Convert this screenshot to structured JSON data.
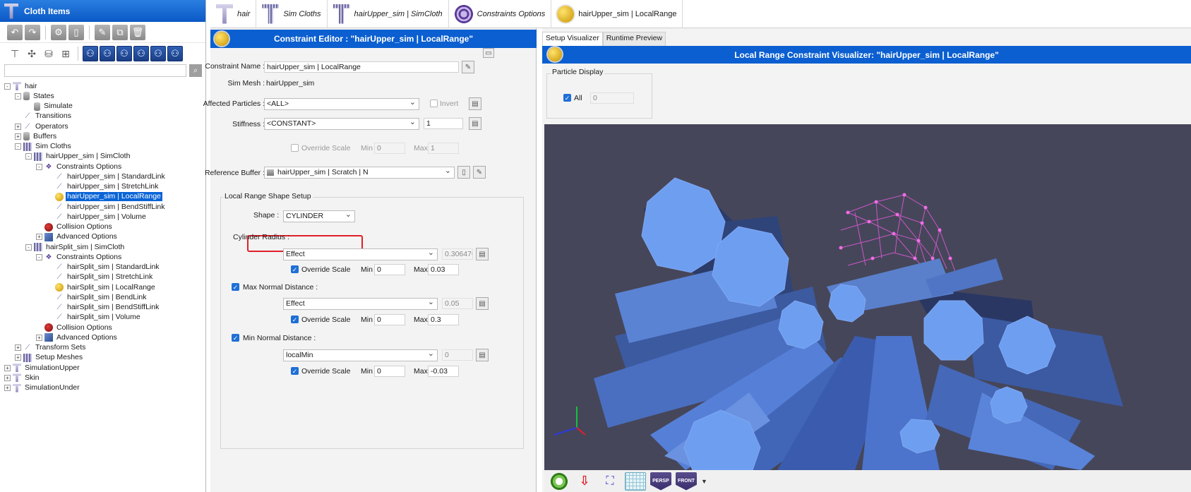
{
  "left_panel": {
    "title": "Cloth Items",
    "search": {
      "value": "",
      "placeholder": ""
    },
    "tree": [
      {
        "label": "hair",
        "depth": 0,
        "exp": "-",
        "icon": "shirt"
      },
      {
        "label": "States",
        "depth": 1,
        "exp": "-",
        "icon": "db"
      },
      {
        "label": "Simulate",
        "depth": 2,
        "exp": "",
        "icon": "db"
      },
      {
        "label": "Transitions",
        "depth": 1,
        "exp": "",
        "icon": "link"
      },
      {
        "label": "Operators",
        "depth": 1,
        "exp": "+",
        "icon": "link"
      },
      {
        "label": "Buffers",
        "depth": 1,
        "exp": "+",
        "icon": "db"
      },
      {
        "label": "Sim Cloths",
        "depth": 1,
        "exp": "-",
        "icon": "mesh"
      },
      {
        "label": "hairUpper_sim | SimCloth",
        "depth": 2,
        "exp": "-",
        "icon": "mesh"
      },
      {
        "label": "Constraints Options",
        "depth": 3,
        "exp": "-",
        "icon": "purple"
      },
      {
        "label": "hairUpper_sim | StandardLink",
        "depth": 4,
        "exp": "",
        "icon": "link"
      },
      {
        "label": "hairUpper_sim | StretchLink",
        "depth": 4,
        "exp": "",
        "icon": "link"
      },
      {
        "label": "hairUpper_sim | LocalRange",
        "depth": 4,
        "exp": "",
        "icon": "ball",
        "selected": true
      },
      {
        "label": "hairUpper_sim | BendStiffLink",
        "depth": 4,
        "exp": "",
        "icon": "link"
      },
      {
        "label": "hairUpper_sim | Volume",
        "depth": 4,
        "exp": "",
        "icon": "link"
      },
      {
        "label": "Collision Options",
        "depth": 3,
        "exp": "",
        "icon": "red"
      },
      {
        "label": "Advanced Options",
        "depth": 3,
        "exp": "+",
        "icon": "cubes"
      },
      {
        "label": "hairSplit_sim | SimCloth",
        "depth": 2,
        "exp": "-",
        "icon": "mesh"
      },
      {
        "label": "Constraints Options",
        "depth": 3,
        "exp": "-",
        "icon": "purple"
      },
      {
        "label": "hairSplit_sim | StandardLink",
        "depth": 4,
        "exp": "",
        "icon": "link"
      },
      {
        "label": "hairSplit_sim | StretchLink",
        "depth": 4,
        "exp": "",
        "icon": "link"
      },
      {
        "label": "hairSplit_sim | LocalRange",
        "depth": 4,
        "exp": "",
        "icon": "ball"
      },
      {
        "label": "hairSplit_sim | BendLink",
        "depth": 4,
        "exp": "",
        "icon": "link"
      },
      {
        "label": "hairSplit_sim | BendStiffLink",
        "depth": 4,
        "exp": "",
        "icon": "link"
      },
      {
        "label": "hairSplit_sim | Volume",
        "depth": 4,
        "exp": "",
        "icon": "link"
      },
      {
        "label": "Collision Options",
        "depth": 3,
        "exp": "",
        "icon": "red"
      },
      {
        "label": "Advanced Options",
        "depth": 3,
        "exp": "+",
        "icon": "cubes"
      },
      {
        "label": "Transform Sets",
        "depth": 1,
        "exp": "+",
        "icon": "link"
      },
      {
        "label": "Setup Meshes",
        "depth": 1,
        "exp": "+",
        "icon": "mesh"
      },
      {
        "label": "SimulationUpper",
        "depth": 0,
        "exp": "+",
        "icon": "shirt"
      },
      {
        "label": "Skin",
        "depth": 0,
        "exp": "+",
        "icon": "shirt"
      },
      {
        "label": "SimulationUnder",
        "depth": 0,
        "exp": "+",
        "icon": "shirt"
      }
    ]
  },
  "tabs": [
    {
      "label": "hair",
      "icon": "shirt"
    },
    {
      "label": "Sim Cloths",
      "icon": "mesh"
    },
    {
      "label": "hairUpper_sim | SimCloth",
      "icon": "mesh"
    },
    {
      "label": "Constraints Options",
      "icon": "purple"
    },
    {
      "label": "hairUpper_sim | LocalRange",
      "icon": "ball",
      "active": true
    }
  ],
  "editor": {
    "title": "Constraint Editor : \"hairUpper_sim | LocalRange\"",
    "constraint_name_label": "Constraint Name :",
    "constraint_name_value": "hairUpper_sim | LocalRange",
    "sim_mesh_label": "Sim Mesh :",
    "sim_mesh_value": "hairUpper_sim",
    "affected_label": "Affected Particles :",
    "affected_value": "<ALL>",
    "invert_label": "Invert",
    "stiffness_label": "Stiffness :",
    "stiffness_select": "<CONSTANT>",
    "stiffness_value": "1",
    "override_scale_label": "Override Scale",
    "min_label": "Min",
    "max_label": "Max",
    "stiff_min": "0",
    "stiff_max": "1",
    "reference_label": "Reference Buffer :",
    "reference_value": "hairUpper_sim | Scratch | N",
    "group_title": "Local Range Shape Setup",
    "shape_label": "Shape :",
    "shape_value": "CYLINDER",
    "cyl_radius_label": "Cylinder Radius :",
    "cyl_radius_select": "Effect",
    "cyl_radius_value": "0.3064765",
    "cyl_min": "0",
    "cyl_max": "0.03",
    "max_normal_label": "Max Normal Distance :",
    "max_normal_select": "Effect",
    "max_normal_value": "0.05",
    "maxn_min": "0",
    "maxn_max": "0.3",
    "min_normal_label": "Min Normal Distance :",
    "min_normal_select": "localMin",
    "min_normal_value": "0",
    "minn_min": "0",
    "minn_max": "-0.03"
  },
  "visualizer": {
    "tab_setup": "Setup Visualizer",
    "tab_runtime": "Runtime Preview",
    "title": "Local Range Constraint Visualizer: \"hairUpper_sim | LocalRange\"",
    "particle_display_label": "Particle Display",
    "all_label": "All",
    "particle_value": "0",
    "persp_label": "PERSP",
    "front_label": "FRONT"
  }
}
